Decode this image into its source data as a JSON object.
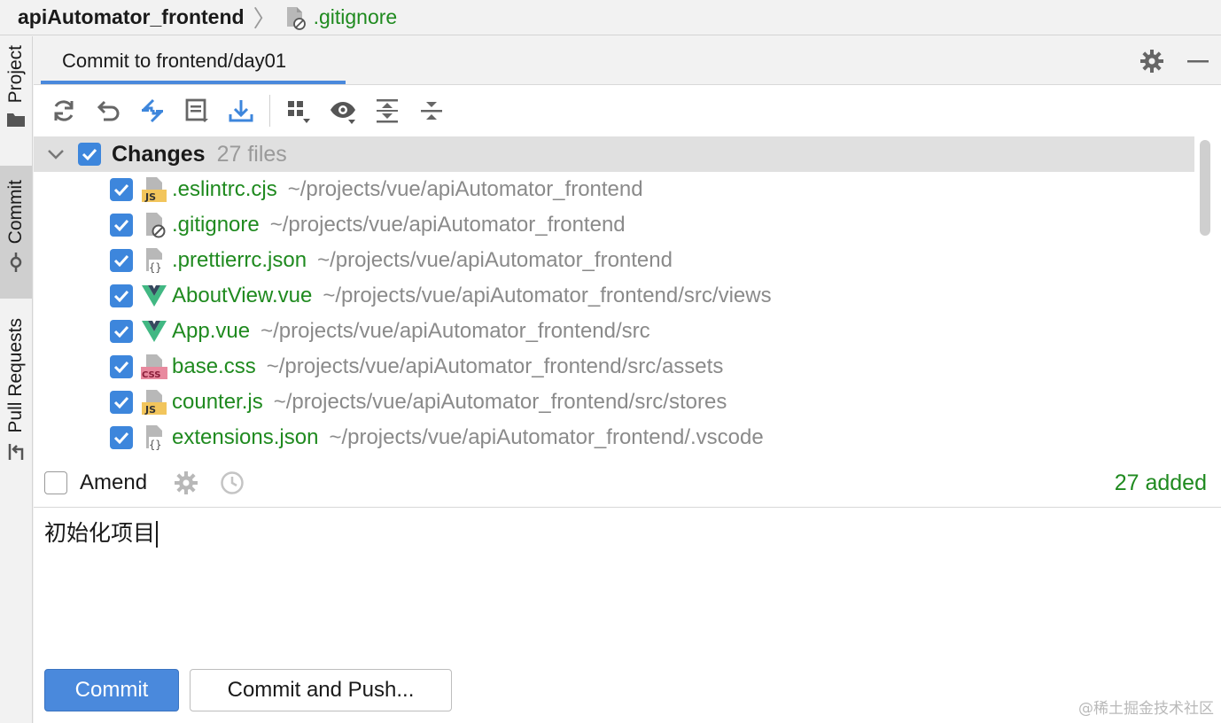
{
  "breadcrumb": {
    "project": "apiAutomator_frontend",
    "separator": "〉",
    "file": ".gitignore"
  },
  "tool_window_strip": {
    "items": [
      {
        "label": "Project",
        "icon": "folder-icon"
      },
      {
        "label": "Commit",
        "icon": "commit-icon",
        "active": true
      },
      {
        "label": "Pull Requests",
        "icon": "pull-request-icon"
      }
    ]
  },
  "commit_panel": {
    "tab_title": "Commit to frontend/day01",
    "toolbar_icons": [
      "refresh-icon",
      "rollback-icon",
      "diff-icon",
      "shelve-icon",
      "update-icon",
      "group-by-icon",
      "view-options-icon",
      "expand-all-icon",
      "collapse-all-icon"
    ],
    "changes": {
      "title": "Changes",
      "count_text": "27 files",
      "files": [
        {
          "name": ".eslintrc.cjs",
          "path": "~/projects/vue/apiAutomator_frontend",
          "icon": "js-file-icon"
        },
        {
          "name": ".gitignore",
          "path": "~/projects/vue/apiAutomator_frontend",
          "icon": "ignore-file-icon"
        },
        {
          "name": ".prettierrc.json",
          "path": "~/projects/vue/apiAutomator_frontend",
          "icon": "json-file-icon"
        },
        {
          "name": "AboutView.vue",
          "path": "~/projects/vue/apiAutomator_frontend/src/views",
          "icon": "vue-file-icon"
        },
        {
          "name": "App.vue",
          "path": "~/projects/vue/apiAutomator_frontend/src",
          "icon": "vue-file-icon"
        },
        {
          "name": "base.css",
          "path": "~/projects/vue/apiAutomator_frontend/src/assets",
          "icon": "css-file-icon"
        },
        {
          "name": "counter.js",
          "path": "~/projects/vue/apiAutomator_frontend/src/stores",
          "icon": "js-file-icon"
        },
        {
          "name": "extensions.json",
          "path": "~/projects/vue/apiAutomator_frontend/.vscode",
          "icon": "json-file-icon"
        }
      ]
    },
    "amend": {
      "label": "Amend",
      "checked": false
    },
    "added_text": "27 added",
    "message": "初始化项目",
    "buttons": {
      "commit": "Commit",
      "commit_and_push": "Commit and Push..."
    }
  },
  "watermark": "@稀土掘金技术社区",
  "colors": {
    "accent": "#4a89dc",
    "added_green": "#1f8a1f",
    "path_gray": "#8a8a8a",
    "vue_green": "#41b883"
  }
}
